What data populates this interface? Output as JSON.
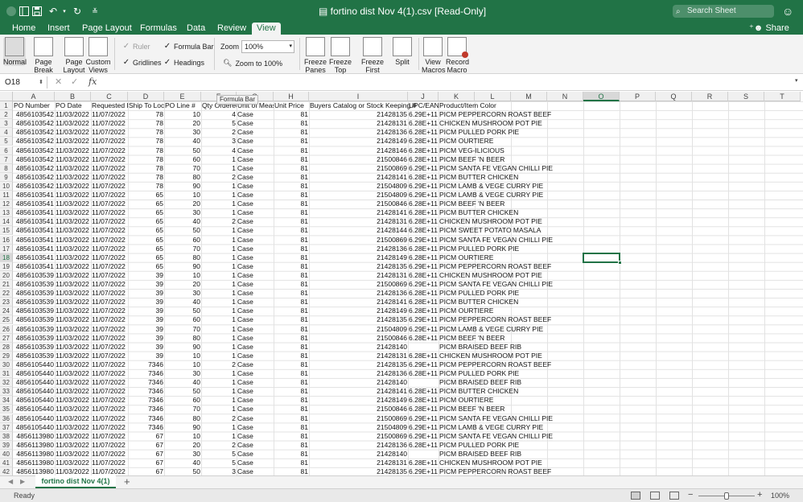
{
  "app": {
    "title": "fortino dist Nov 4(1).csv  [Read-Only]",
    "search_placeholder": "Search Sheet",
    "accent": "#217346"
  },
  "ribbon_tabs": [
    "Home",
    "Insert",
    "Page Layout",
    "Formulas",
    "Data",
    "Review",
    "View"
  ],
  "active_tab": "View",
  "share_label": "Share",
  "view_ribbon": {
    "workbook_views": [
      "Normal",
      "Page Break Preview",
      "Page Layout",
      "Custom Views"
    ],
    "show": {
      "ruler": "Ruler",
      "formula_bar": "Formula Bar",
      "gridlines": "Gridlines",
      "headings": "Headings"
    },
    "zoom_label": "Zoom",
    "zoom_value": "100%",
    "zoom_to_100": "Zoom to 100%",
    "freeze": [
      "Freeze Panes",
      "Freeze Top Row",
      "Freeze First Column"
    ],
    "split": "Split",
    "macros": [
      "View Macros",
      "Record Macro"
    ]
  },
  "formula_bar": {
    "name_box": "O18",
    "formula": "",
    "fx": "fx",
    "tooltip": "Formula Bar"
  },
  "columns": [
    "A",
    "B",
    "C",
    "D",
    "E",
    "F",
    "G",
    "H",
    "I",
    "J",
    "K",
    "L",
    "M",
    "N",
    "O",
    "P",
    "Q",
    "R",
    "S",
    "T"
  ],
  "active_column": "O",
  "active_row": 18,
  "headers": [
    "PO Number",
    "PO Date",
    "Requested D",
    "Ship To Locat",
    "PO Line #",
    "Qty Ordered",
    "Unit of Meas",
    "Unit Price",
    "Buyers Catalog or Stock Keeping #",
    "UPC/EAN",
    "Product/Item Color"
  ],
  "rows": [
    [
      "4856103542",
      "11/03/2022",
      "11/07/2022",
      "78",
      "10",
      "4",
      "Case",
      "81",
      "21428135",
      "6.29E+11",
      "PICM PEPPERCORN ROAST BEEF"
    ],
    [
      "4856103542",
      "11/03/2022",
      "11/07/2022",
      "78",
      "20",
      "5",
      "Case",
      "81",
      "21428131",
      "6.28E+11",
      "CHICKEN MUSHROOM POT PIE"
    ],
    [
      "4856103542",
      "11/03/2022",
      "11/07/2022",
      "78",
      "30",
      "2",
      "Case",
      "81",
      "21428136",
      "6.28E+11",
      "PICM PULLED PORK PIE"
    ],
    [
      "4856103542",
      "11/03/2022",
      "11/07/2022",
      "78",
      "40",
      "3",
      "Case",
      "81",
      "21428149",
      "6.28E+11",
      "PICM OURTIERE"
    ],
    [
      "4856103542",
      "11/03/2022",
      "11/07/2022",
      "78",
      "50",
      "4",
      "Case",
      "81",
      "21428146",
      "6.28E+11",
      "PICM VEG-ILICIOUS"
    ],
    [
      "4856103542",
      "11/03/2022",
      "11/07/2022",
      "78",
      "60",
      "1",
      "Case",
      "81",
      "21500846",
      "6.28E+11",
      "PICM BEEF 'N BEER"
    ],
    [
      "4856103542",
      "11/03/2022",
      "11/07/2022",
      "78",
      "70",
      "1",
      "Case",
      "81",
      "21500869",
      "6.29E+11",
      "PICM SANTA FE VEGAN CHILLI PIE"
    ],
    [
      "4856103542",
      "11/03/2022",
      "11/07/2022",
      "78",
      "80",
      "2",
      "Case",
      "81",
      "21428141",
      "6.28E+11",
      "PICM BUTTER CHICKEN"
    ],
    [
      "4856103542",
      "11/03/2022",
      "11/07/2022",
      "78",
      "90",
      "1",
      "Case",
      "81",
      "21504809",
      "6.29E+11",
      "PICM LAMB & VEGE CURRY PIE"
    ],
    [
      "4856103541",
      "11/03/2022",
      "11/07/2022",
      "65",
      "10",
      "1",
      "Case",
      "81",
      "21504809",
      "6.29E+11",
      "PICM LAMB & VEGE CURRY PIE"
    ],
    [
      "4856103541",
      "11/03/2022",
      "11/07/2022",
      "65",
      "20",
      "1",
      "Case",
      "81",
      "21500846",
      "6.28E+11",
      "PICM BEEF 'N BEER"
    ],
    [
      "4856103541",
      "11/03/2022",
      "11/07/2022",
      "65",
      "30",
      "1",
      "Case",
      "81",
      "21428141",
      "6.28E+11",
      "PICM BUTTER CHICKEN"
    ],
    [
      "4856103541",
      "11/03/2022",
      "11/07/2022",
      "65",
      "40",
      "2",
      "Case",
      "81",
      "21428131",
      "6.28E+11",
      "CHICKEN MUSHROOM POT PIE"
    ],
    [
      "4856103541",
      "11/03/2022",
      "11/07/2022",
      "65",
      "50",
      "1",
      "Case",
      "81",
      "21428144",
      "6.28E+11",
      "PICM SWEET POTATO MASALA"
    ],
    [
      "4856103541",
      "11/03/2022",
      "11/07/2022",
      "65",
      "60",
      "1",
      "Case",
      "81",
      "21500869",
      "6.29E+11",
      "PICM SANTA FE VEGAN CHILLI PIE"
    ],
    [
      "4856103541",
      "11/03/2022",
      "11/07/2022",
      "65",
      "70",
      "1",
      "Case",
      "81",
      "21428136",
      "6.28E+11",
      "PICM PULLED PORK PIE"
    ],
    [
      "4856103541",
      "11/03/2022",
      "11/07/2022",
      "65",
      "80",
      "1",
      "Case",
      "81",
      "21428149",
      "6.28E+11",
      "PICM OURTIERE"
    ],
    [
      "4856103541",
      "11/03/2022",
      "11/07/2022",
      "65",
      "90",
      "1",
      "Case",
      "81",
      "21428135",
      "6.29E+11",
      "PICM PEPPERCORN ROAST BEEF"
    ],
    [
      "4856103539",
      "11/03/2022",
      "11/07/2022",
      "39",
      "10",
      "1",
      "Case",
      "81",
      "21428131",
      "6.28E+11",
      "CHICKEN MUSHROOM POT PIE"
    ],
    [
      "4856103539",
      "11/03/2022",
      "11/07/2022",
      "39",
      "20",
      "1",
      "Case",
      "81",
      "21500869",
      "6.29E+11",
      "PICM SANTA FE VEGAN CHILLI PIE"
    ],
    [
      "4856103539",
      "11/03/2022",
      "11/07/2022",
      "39",
      "30",
      "1",
      "Case",
      "81",
      "21428136",
      "6.28E+11",
      "PICM PULLED PORK PIE"
    ],
    [
      "4856103539",
      "11/03/2022",
      "11/07/2022",
      "39",
      "40",
      "1",
      "Case",
      "81",
      "21428141",
      "6.28E+11",
      "PICM BUTTER CHICKEN"
    ],
    [
      "4856103539",
      "11/03/2022",
      "11/07/2022",
      "39",
      "50",
      "1",
      "Case",
      "81",
      "21428149",
      "6.28E+11",
      "PICM OURTIERE"
    ],
    [
      "4856103539",
      "11/03/2022",
      "11/07/2022",
      "39",
      "60",
      "1",
      "Case",
      "81",
      "21428135",
      "6.29E+11",
      "PICM PEPPERCORN ROAST BEEF"
    ],
    [
      "4856103539",
      "11/03/2022",
      "11/07/2022",
      "39",
      "70",
      "1",
      "Case",
      "81",
      "21504809",
      "6.29E+11",
      "PICM LAMB & VEGE CURRY PIE"
    ],
    [
      "4856103539",
      "11/03/2022",
      "11/07/2022",
      "39",
      "80",
      "1",
      "Case",
      "81",
      "21500846",
      "6.28E+11",
      "PICM BEEF 'N BEER"
    ],
    [
      "4856103539",
      "11/03/2022",
      "11/07/2022",
      "39",
      "90",
      "1",
      "Case",
      "81",
      "21428140",
      "",
      "PICM BRAISED BEEF RIB"
    ],
    [
      "4856103539",
      "11/03/2022",
      "11/07/2022",
      "39",
      "10",
      "1",
      "Case",
      "81",
      "21428131",
      "6.28E+11",
      "CHICKEN MUSHROOM POT PIE"
    ],
    [
      "4856105440",
      "11/03/2022",
      "11/07/2022",
      "7346",
      "10",
      "2",
      "Case",
      "81",
      "21428135",
      "6.29E+11",
      "PICM PEPPERCORN ROAST BEEF"
    ],
    [
      "4856105440",
      "11/03/2022",
      "11/07/2022",
      "7346",
      "30",
      "1",
      "Case",
      "81",
      "21428136",
      "6.28E+11",
      "PICM PULLED PORK PIE"
    ],
    [
      "4856105440",
      "11/03/2022",
      "11/07/2022",
      "7346",
      "40",
      "1",
      "Case",
      "81",
      "21428140",
      "",
      "PICM BRAISED BEEF RIB"
    ],
    [
      "4856105440",
      "11/03/2022",
      "11/07/2022",
      "7346",
      "50",
      "1",
      "Case",
      "81",
      "21428141",
      "6.28E+11",
      "PICM BUTTER CHICKEN"
    ],
    [
      "4856105440",
      "11/03/2022",
      "11/07/2022",
      "7346",
      "60",
      "1",
      "Case",
      "81",
      "21428149",
      "6.28E+11",
      "PICM OURTIERE"
    ],
    [
      "4856105440",
      "11/03/2022",
      "11/07/2022",
      "7346",
      "70",
      "1",
      "Case",
      "81",
      "21500846",
      "6.28E+11",
      "PICM BEEF 'N BEER"
    ],
    [
      "4856105440",
      "11/03/2022",
      "11/07/2022",
      "7346",
      "80",
      "2",
      "Case",
      "81",
      "21500869",
      "6.29E+11",
      "PICM SANTA FE VEGAN CHILLI PIE"
    ],
    [
      "4856105440",
      "11/03/2022",
      "11/07/2022",
      "7346",
      "90",
      "1",
      "Case",
      "81",
      "21504809",
      "6.29E+11",
      "PICM LAMB & VEGE CURRY PIE"
    ],
    [
      "4856113980",
      "11/03/2022",
      "11/07/2022",
      "67",
      "10",
      "1",
      "Case",
      "81",
      "21500869",
      "6.29E+11",
      "PICM SANTA FE VEGAN CHILLI PIE"
    ],
    [
      "4856113980",
      "11/03/2022",
      "11/07/2022",
      "67",
      "20",
      "2",
      "Case",
      "81",
      "21428136",
      "6.28E+11",
      "PICM PULLED PORK PIE"
    ],
    [
      "4856113980",
      "11/03/2022",
      "11/07/2022",
      "67",
      "30",
      "5",
      "Case",
      "81",
      "21428140",
      "",
      "PICM BRAISED BEEF RIB"
    ],
    [
      "4856113980",
      "11/03/2022",
      "11/07/2022",
      "67",
      "40",
      "5",
      "Case",
      "81",
      "21428131",
      "6.28E+11",
      "CHICKEN MUSHROOM POT PIE"
    ],
    [
      "4856113980",
      "11/03/2022",
      "11/07/2022",
      "67",
      "50",
      "3",
      "Case",
      "81",
      "21428135",
      "6.29E+11",
      "PICM PEPPERCORN ROAST BEEF"
    ]
  ],
  "row_numbers": [
    "1",
    "2",
    "3",
    "4",
    "5",
    "6",
    "7",
    "8",
    "9",
    "10",
    "11",
    "12",
    "13",
    "14",
    "15",
    "16",
    "17",
    "18",
    "19",
    "20",
    "21",
    "22",
    "23",
    "24",
    "25",
    "26",
    "27",
    "28",
    "29",
    "30",
    "31",
    "32",
    "33",
    "34",
    "35",
    "36",
    "37",
    "38",
    "39",
    "40",
    "41",
    "42"
  ],
  "sheet_tab": "fortino dist Nov 4(1)",
  "status": {
    "text": "Ready",
    "zoom_pct": "100%",
    "zoom_level": 1.0
  }
}
